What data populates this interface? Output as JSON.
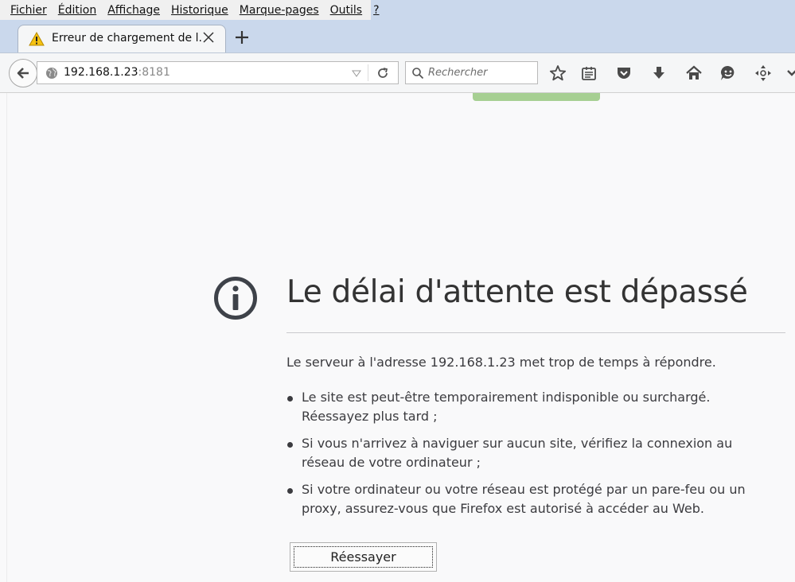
{
  "menubar": {
    "items": [
      {
        "label": "Fichier"
      },
      {
        "label": "Édition"
      },
      {
        "label": "Affichage"
      },
      {
        "label": "Historique"
      },
      {
        "label": "Marque-pages"
      },
      {
        "label": "Outils"
      },
      {
        "label": "?"
      }
    ]
  },
  "tab": {
    "title": "Erreur de chargement de l...",
    "icon": "warning-icon"
  },
  "navbar": {
    "url_host": "192.168.1.23",
    "url_port": ":8181",
    "search_placeholder": "Rechercher",
    "icons": [
      "bookmark-star-icon",
      "reading-list-icon",
      "pocket-icon",
      "download-icon",
      "home-icon",
      "hello-icon",
      "scroll-icon"
    ]
  },
  "error": {
    "title": "Le délai d'attente est dépassé",
    "description": "Le serveur à l'adresse 192.168.1.23 met trop de temps à répondre.",
    "reasons": [
      "Le site est peut-être temporairement indisponible ou surchargé. Réessayez plus tard ;",
      "Si vous n'arrivez à naviguer sur aucun site, vérifiez la connexion au réseau de votre ordinateur ;",
      "Si votre ordinateur ou votre réseau est protégé par un pare-feu ou un proxy, assurez-vous que Firefox est autorisé à accéder au Web."
    ],
    "retry_label": "Réessayer"
  },
  "colors": {
    "chrome_blue": "#cad8ec",
    "accent_green": "#a6cf92",
    "text": "#3b3b3f"
  }
}
